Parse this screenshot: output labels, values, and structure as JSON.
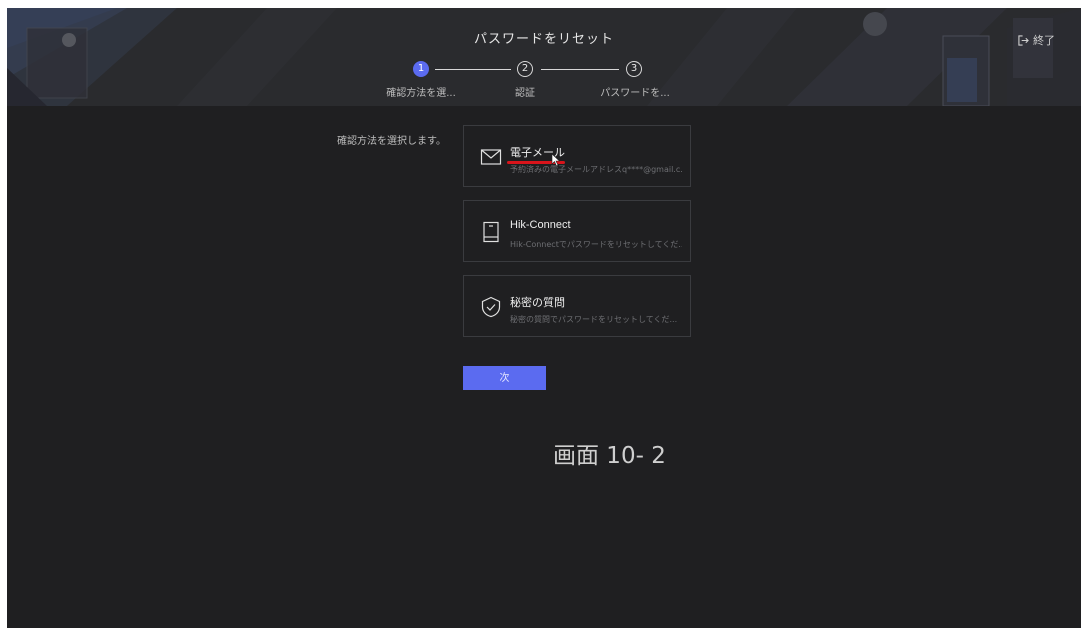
{
  "header": {
    "title": "パスワードをリセット",
    "exit_label": "終了"
  },
  "steps": [
    {
      "number": "1",
      "label": "確認方法を選...",
      "state": "active"
    },
    {
      "number": "2",
      "label": "認証",
      "state": "inactive"
    },
    {
      "number": "3",
      "label": "パスワードを...",
      "state": "inactive"
    }
  ],
  "prompt": "確認方法を選択します。",
  "options": [
    {
      "title": "電子メール",
      "description": "予約済みの電子メールアドレスq****@gmail.c...",
      "icon": "mail-icon"
    },
    {
      "title": "Hik-Connect",
      "description": "Hik-Connectでパスワードをリセットしてくだ...",
      "icon": "phone-icon"
    },
    {
      "title": "秘密の質問",
      "description": "秘密の質問でパスワードをリセットしてくだ...",
      "icon": "shield-check-icon"
    }
  ],
  "next_button": "次",
  "caption": "画面 10- 2",
  "colors": {
    "accent": "#5b6bf0",
    "background": "#1f1f21",
    "annotation_underline": "#d8141b"
  }
}
